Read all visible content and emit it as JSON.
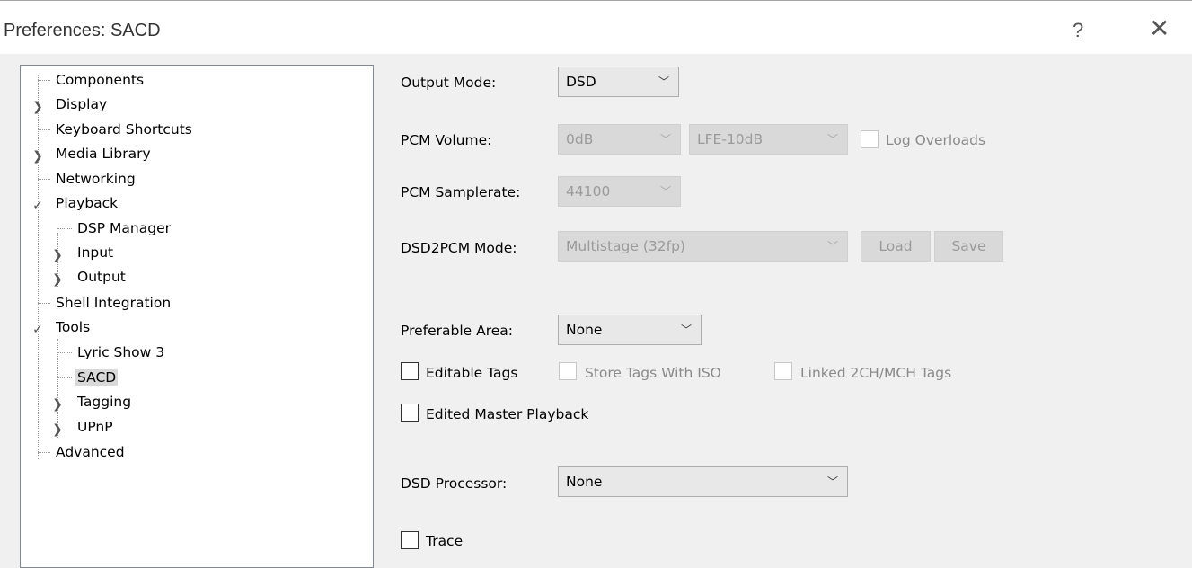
{
  "window": {
    "title": "Preferences: SACD",
    "help_glyph": "?",
    "close_glyph": "✕"
  },
  "tree": {
    "items": [
      {
        "label": "Components"
      },
      {
        "label": "Display"
      },
      {
        "label": "Keyboard Shortcuts"
      },
      {
        "label": "Media Library"
      },
      {
        "label": "Networking"
      },
      {
        "label": "Playback"
      },
      {
        "label": "DSP Manager"
      },
      {
        "label": "Input"
      },
      {
        "label": "Output"
      },
      {
        "label": "Shell Integration"
      },
      {
        "label": "Tools"
      },
      {
        "label": "Lyric Show 3"
      },
      {
        "label": "SACD"
      },
      {
        "label": "Tagging"
      },
      {
        "label": "UPnP"
      },
      {
        "label": "Advanced"
      }
    ],
    "selected": "SACD",
    "expand_glyph": "❯",
    "collapse_glyph": "✓"
  },
  "form": {
    "output_mode": {
      "label": "Output Mode:",
      "value": "DSD"
    },
    "pcm_volume": {
      "label": "PCM Volume:",
      "value": "0dB",
      "lfe_value": "LFE-10dB",
      "log_overloads": "Log Overloads"
    },
    "pcm_samplerate": {
      "label": "PCM Samplerate:",
      "value": "44100"
    },
    "dsd2pcm_mode": {
      "label": "DSD2PCM Mode:",
      "value": "Multistage (32fp)",
      "load": "Load",
      "save": "Save"
    },
    "preferable_area": {
      "label": "Preferable Area:",
      "value": "None"
    },
    "editable_tags": "Editable Tags",
    "store_tags_with_iso": "Store Tags With ISO",
    "linked_tags": "Linked 2CH/MCH Tags",
    "edited_master_playback": "Edited Master Playback",
    "dsd_processor": {
      "label": "DSD Processor:",
      "value": "None"
    },
    "trace": "Trace"
  },
  "colors": {
    "panel": "#f0f0f0",
    "disabled_text": "#9a9a9a",
    "selection": "#d9d9d9"
  }
}
